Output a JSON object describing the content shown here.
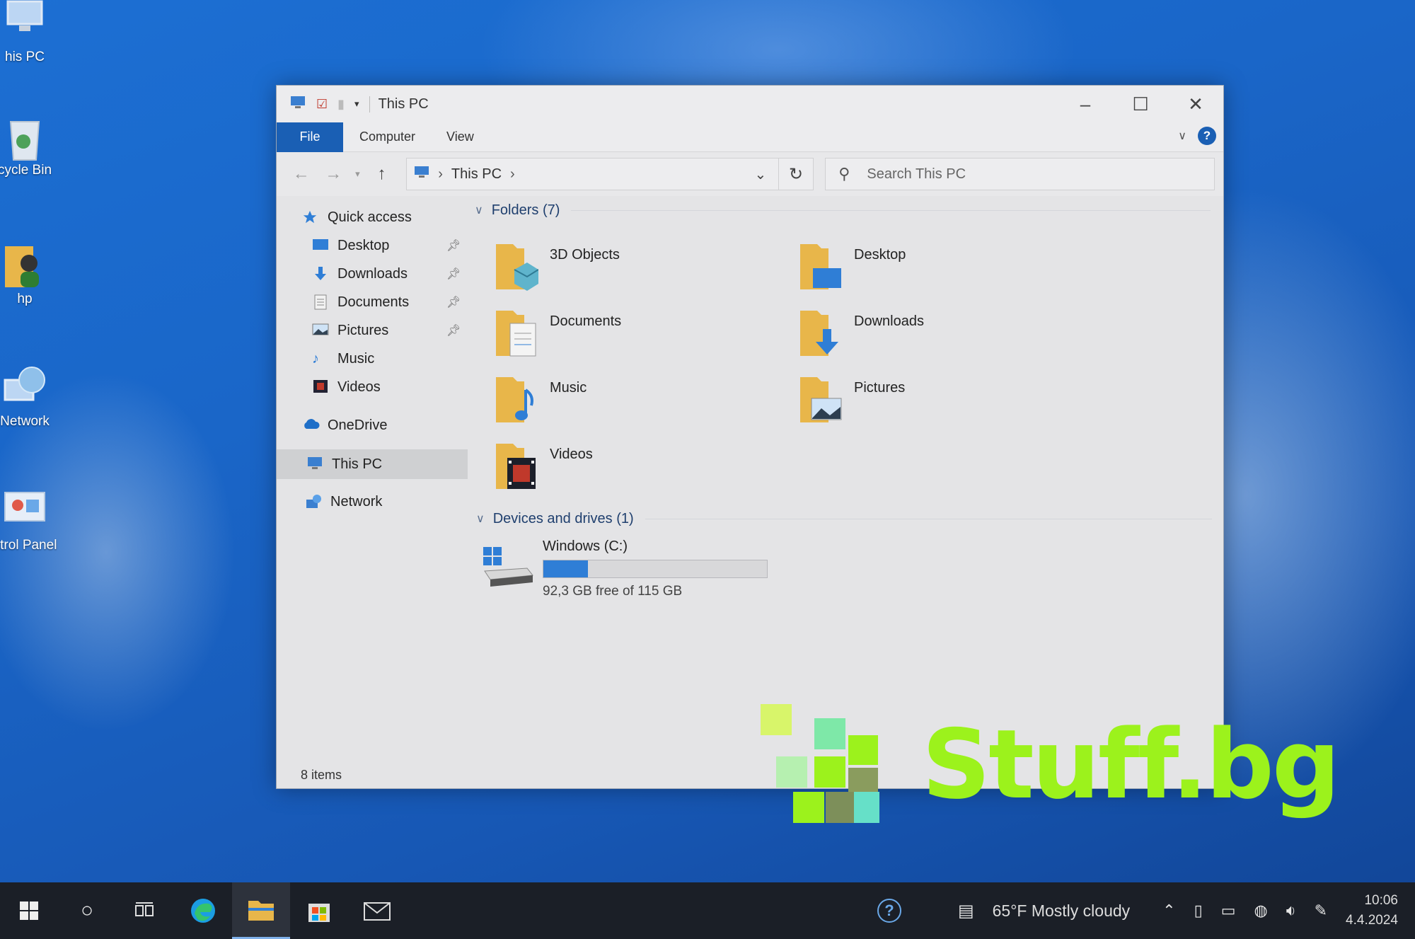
{
  "desktop": {
    "icons": [
      {
        "label": "his PC"
      },
      {
        "label": "cycle Bin"
      },
      {
        "label": "hp"
      },
      {
        "label": "Network"
      },
      {
        "label": "ntrol Panel"
      }
    ]
  },
  "window": {
    "title": "This PC",
    "ribbon_tabs": [
      "File",
      "Computer",
      "View"
    ],
    "address": {
      "crumb": "This PC"
    },
    "search": {
      "placeholder": "Search This PC"
    },
    "sidebar": {
      "quick_access": "Quick access",
      "quick_items": [
        {
          "label": "Desktop",
          "icon": "desktop-icon",
          "pinned": true
        },
        {
          "label": "Downloads",
          "icon": "download-icon",
          "pinned": true
        },
        {
          "label": "Documents",
          "icon": "documents-icon",
          "pinned": true
        },
        {
          "label": "Pictures",
          "icon": "pictures-icon",
          "pinned": true
        },
        {
          "label": "Music",
          "icon": "music-icon",
          "pinned": false
        },
        {
          "label": "Videos",
          "icon": "videos-icon",
          "pinned": false
        }
      ],
      "onedrive": "OneDrive",
      "this_pc": "This PC",
      "network": "Network"
    },
    "folders_header": "Folders (7)",
    "folders": [
      {
        "label": "3D Objects"
      },
      {
        "label": "Desktop"
      },
      {
        "label": "Documents"
      },
      {
        "label": "Downloads"
      },
      {
        "label": "Music"
      },
      {
        "label": "Pictures"
      },
      {
        "label": "Videos"
      }
    ],
    "devices_header": "Devices and drives (1)",
    "drive": {
      "label": "Windows (C:)",
      "free_text": "92,3 GB free of 115 GB",
      "used_fraction": 0.2
    },
    "status": "8 items"
  },
  "watermark": {
    "text": "Stuff.bg"
  },
  "taskbar": {
    "weather": "65°F  Mostly cloudy",
    "time": "10:06",
    "date": "4.4.2024"
  },
  "colors": {
    "accent": "#1a5fb4",
    "drive_bar": "#2f7ed6",
    "folder": "#e8b64a",
    "watermark": "#9cf21c"
  }
}
